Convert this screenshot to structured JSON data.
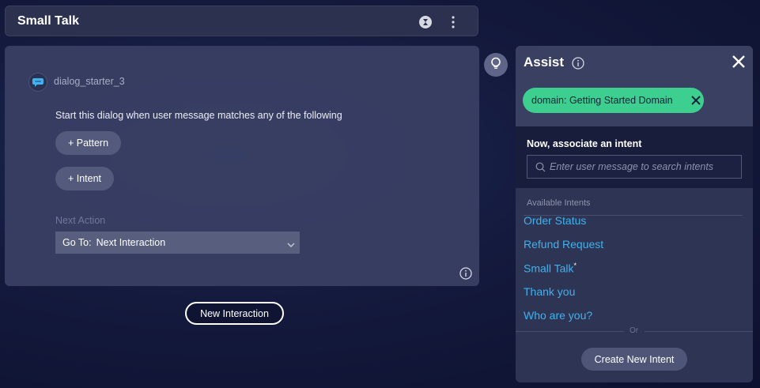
{
  "header": {
    "title": "Small Talk",
    "icons": [
      "status-icon",
      "more-vertical-icon"
    ]
  },
  "dialog": {
    "bot_name": "dialog_starter_3",
    "description": "Start this dialog when user message matches any of the following",
    "pattern_button": "+ Pattern",
    "intent_button": "+ Intent",
    "next_action_label": "Next Action",
    "go_to_prefix": "Go To:",
    "go_to_value": "Next Interaction"
  },
  "new_interaction_button": "New Interaction",
  "assist": {
    "title": "Assist",
    "domain_chip": "domain: Getting Started Domain",
    "associate_label": "Now, associate an intent",
    "search_placeholder": "Enter user message to search intents",
    "available_label": "Available Intents",
    "intents": [
      {
        "label": "Order Status",
        "mark": ""
      },
      {
        "label": "Refund Request",
        "mark": ""
      },
      {
        "label": "Small Talk",
        "mark": "*"
      },
      {
        "label": "Thank you",
        "mark": ""
      },
      {
        "label": "Who are you?",
        "mark": ""
      }
    ],
    "or_label": "Or",
    "create_button": "Create New Intent"
  },
  "colors": {
    "accent_green": "#3ccf8f",
    "intent_link": "#3fb2ef",
    "panel_bg": "#2e3453"
  }
}
